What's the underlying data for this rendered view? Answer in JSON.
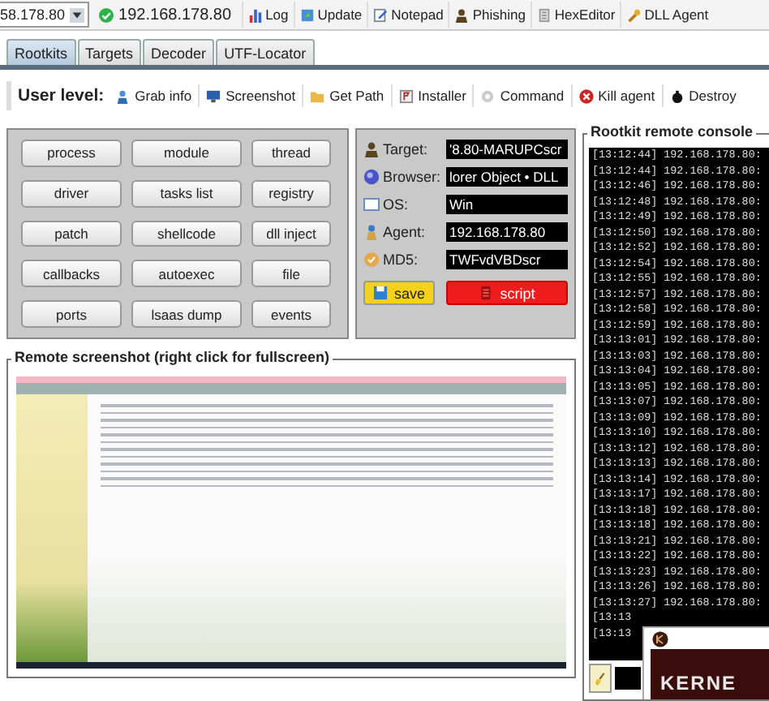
{
  "top_bar": {
    "host_select": {
      "value": "58.178.80"
    },
    "connection": {
      "label": "192.168.178.80",
      "connected": true
    },
    "buttons": [
      {
        "label": "Log"
      },
      {
        "label": "Update"
      },
      {
        "label": "Notepad"
      },
      {
        "label": "Phishing"
      },
      {
        "label": "HexEditor"
      },
      {
        "label": "DLL Agent"
      }
    ]
  },
  "tabs": [
    {
      "label": "Rootkits",
      "selected": true
    },
    {
      "label": "Targets",
      "selected": false
    },
    {
      "label": "Decoder",
      "selected": false
    },
    {
      "label": "UTF-Locator",
      "selected": false
    }
  ],
  "action_bar": {
    "label": "User level:",
    "actions": [
      {
        "label": "Grab info"
      },
      {
        "label": "Screenshot"
      },
      {
        "label": "Get Path"
      },
      {
        "label": "Installer"
      },
      {
        "label": "Command"
      },
      {
        "label": "Kill agent"
      },
      {
        "label": "Destroy"
      }
    ]
  },
  "module_buttons": [
    "process",
    "module",
    "thread",
    "driver",
    "tasks list",
    "registry",
    "patch",
    "shellcode",
    "dll inject",
    "callbacks",
    "autoexec",
    "file",
    "ports",
    "lsaas dump",
    "events"
  ],
  "info": {
    "rows": [
      {
        "label": "Target:",
        "value": "'8.80-MARUPCscr"
      },
      {
        "label": "Browser:",
        "value": "lorer Object • DLL"
      },
      {
        "label": "OS:",
        "value": "Win"
      },
      {
        "label": "Agent:",
        "value": "192.168.178.80"
      },
      {
        "label": "MD5:",
        "value": "TWFvdVBDscr"
      }
    ],
    "buttons": [
      {
        "label": "save"
      },
      {
        "label": "script"
      }
    ]
  },
  "screenshot_panel": {
    "title": "Remote screenshot (right click for fullscreen)"
  },
  "console": {
    "title": "Rootkit remote console",
    "lines": [
      "[13:12:44] 192.168.178.80:",
      "[13:12:44] 192.168.178.80:",
      "[13:12:46] 192.168.178.80:",
      "[13:12:48] 192.168.178.80:",
      "[13:12:49] 192.168.178.80:",
      "[13:12:50] 192.168.178.80:",
      "[13:12:52] 192.168.178.80:",
      "[13:12:54] 192.168.178.80:",
      "[13:12:55] 192.168.178.80:",
      "[13:12:57] 192.168.178.80:",
      "[13:12:58] 192.168.178.80:",
      "[13:12:59] 192.168.178.80:",
      "[13:13:01] 192.168.178.80:",
      "[13:13:03] 192.168.178.80:",
      "[13:13:04] 192.168.178.80:",
      "[13:13:05] 192.168.178.80:",
      "[13:13:07] 192.168.178.80:",
      "[13:13:09] 192.168.178.80:",
      "[13:13:10] 192.168.178.80:",
      "[13:13:12] 192.168.178.80:",
      "[13:13:13] 192.168.178.80:",
      "[13:13:14] 192.168.178.80:",
      "[13:13:17] 192.168.178.80:",
      "[13:13:18] 192.168.178.80:",
      "[13:13:18] 192.168.178.80:",
      "[13:13:21] 192.168.178.80:",
      "[13:13:22] 192.168.178.80:",
      "[13:13:23] 192.168.178.80:",
      "[13:13:26] 192.168.178.80:",
      "[13:13:27] 192.168.178.80:",
      "[13:13",
      "[13:13"
    ]
  },
  "popup_window": {
    "banner_text": "KERNE"
  }
}
